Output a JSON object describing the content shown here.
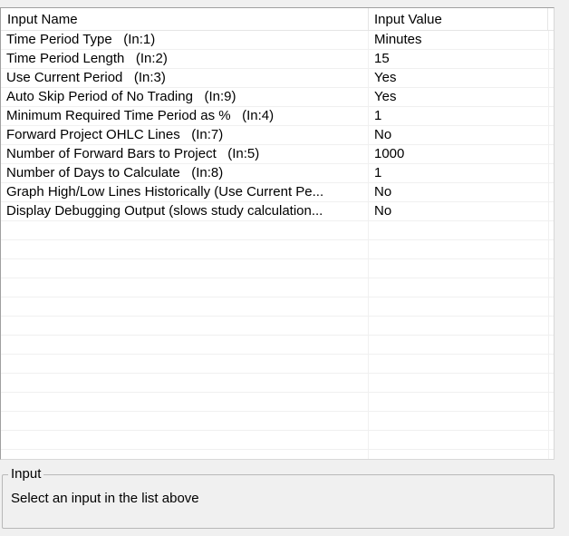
{
  "list": {
    "headers": {
      "name": "Input Name",
      "value": "Input Value"
    },
    "rows": [
      {
        "name": "Time Period Type   (In:1)",
        "value": "Minutes"
      },
      {
        "name": "Time Period Length   (In:2)",
        "value": "15"
      },
      {
        "name": "Use Current Period   (In:3)",
        "value": "Yes"
      },
      {
        "name": "Auto Skip Period of No Trading   (In:9)",
        "value": "Yes"
      },
      {
        "name": "Minimum Required Time Period as %   (In:4)",
        "value": "1"
      },
      {
        "name": "Forward Project OHLC Lines   (In:7)",
        "value": "No"
      },
      {
        "name": "Number of Forward Bars to Project   (In:5)",
        "value": "1000"
      },
      {
        "name": "Number of Days to Calculate   (In:8)",
        "value": "1"
      },
      {
        "name": "Graph High/Low Lines Historically (Use Current Pe...",
        "value": "No"
      },
      {
        "name": "Display Debugging Output (slows study calculation...",
        "value": "No"
      }
    ]
  },
  "input_group": {
    "title": "Input",
    "description": "Select an input in the list above"
  }
}
